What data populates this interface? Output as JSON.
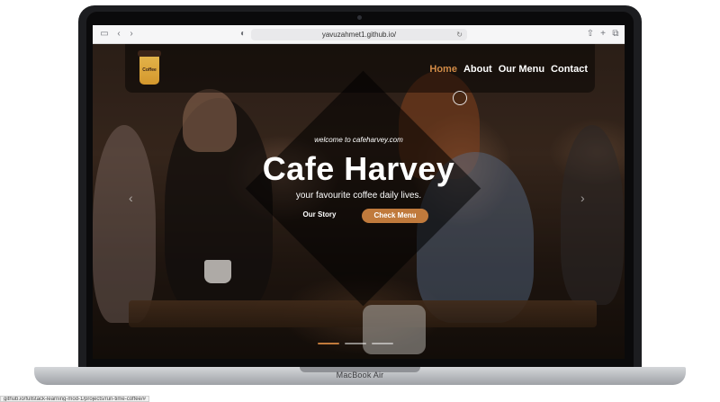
{
  "device": {
    "brand_label": "MacBook Air"
  },
  "browser": {
    "url": "yavuzahmet1.github.io/",
    "status_url": "github.io/fullstack-learning-mod-1/projects/run-time-coffee/#"
  },
  "site": {
    "logo": {
      "label": "Coffee"
    },
    "nav": [
      {
        "label": "Home",
        "active": true
      },
      {
        "label": "About"
      },
      {
        "label": "Our Menu"
      },
      {
        "label": "Contact"
      }
    ],
    "hero": {
      "welcome": "welcome to cafeharvey.com",
      "title": "Cafe Harvey",
      "subtitle": "your favourite coffee daily lives.",
      "btn_story": "Our Story",
      "btn_menu": "Check Menu"
    },
    "slider": {
      "slide_count": 3,
      "active_index": 0
    }
  },
  "colors": {
    "accent": "#c07a3c",
    "nav_active": "#d38b46"
  }
}
